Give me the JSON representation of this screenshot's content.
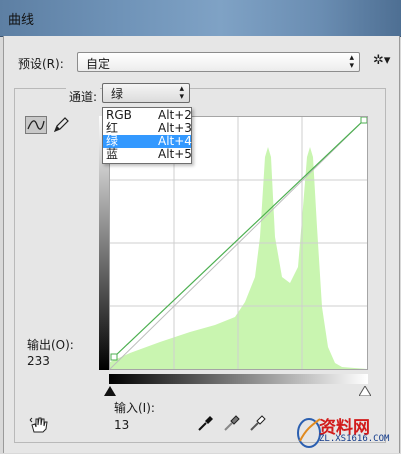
{
  "window": {
    "title": "曲线"
  },
  "preset": {
    "label": "预设(R):",
    "value": "自定"
  },
  "channel": {
    "label": "通道:",
    "value": "绿",
    "options": [
      {
        "name": "RGB",
        "shortcut": "Alt+2",
        "selected": false
      },
      {
        "name": "红",
        "shortcut": "Alt+3",
        "selected": false
      },
      {
        "name": "绿",
        "shortcut": "Alt+4",
        "selected": true
      },
      {
        "name": "蓝",
        "shortcut": "Alt+5",
        "selected": false
      }
    ]
  },
  "output": {
    "label": "输出(O):",
    "value": "233"
  },
  "input": {
    "label": "输入(I):",
    "value": "13"
  },
  "curve": {
    "input_range": [
      0,
      255
    ],
    "output_range": [
      0,
      255
    ],
    "control_points": [
      {
        "input": 13,
        "output": 0
      },
      {
        "input": 255,
        "output": 255
      }
    ],
    "grid_divisions": 4,
    "curve_color": "#4caf50",
    "histogram_color": "#c9f5b0"
  },
  "icons": {
    "gear": "gear-icon",
    "curve_tool": "curve-tool-icon",
    "pencil": "pencil-icon",
    "hand": "hand-adjust-icon",
    "droppers": [
      "black-eyedropper-icon",
      "gray-eyedropper-icon",
      "white-eyedropper-icon"
    ]
  },
  "watermark": {
    "brand": "资料网",
    "url": "ZL.XS1616.COM"
  }
}
